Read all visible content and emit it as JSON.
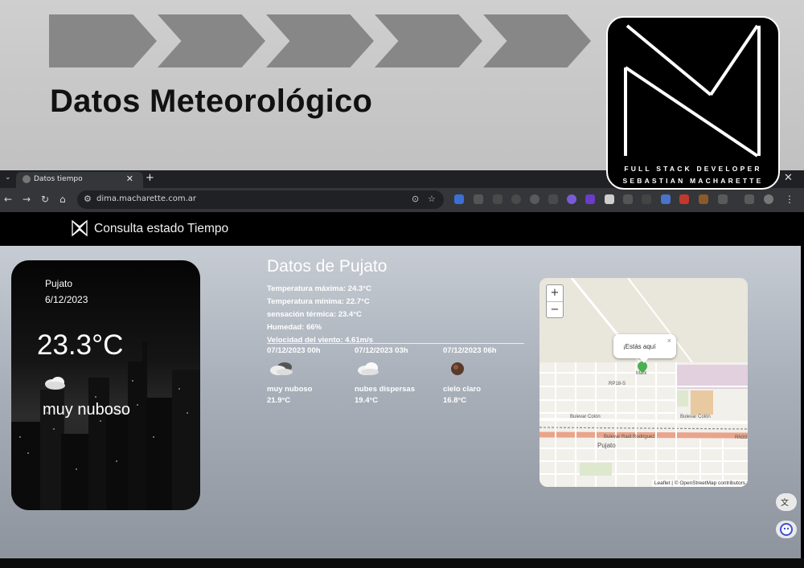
{
  "banner": {
    "title": "Datos Meteorológico",
    "logo_line1": "FULL STACK DEVELOPER",
    "logo_line2": "SEBASTIAN MACHARETTE"
  },
  "browser": {
    "tab_title": "Datos tiempo",
    "url": "dima.macharette.com.ar"
  },
  "site": {
    "header_title": "Consulta estado Tiempo"
  },
  "weather_card": {
    "city": "Pujato",
    "date": "6/12/2023",
    "temperature": "23.3°C",
    "description": "muy nuboso",
    "icon": "cloud-icon"
  },
  "details": {
    "title": "Datos de Pujato",
    "stats": [
      "Temperatura máxima: 24.3°C",
      "Temperatura mínima: 22.7°C",
      "sensación térmica: 23.4°C",
      "Humedad: 66%",
      "Velocidad del viento: 4.61m/s"
    ],
    "forecast": [
      {
        "time": "07/12/2023 00h",
        "description": "muy nuboso",
        "temp": "21.9°C",
        "icon": "cloudy-icon"
      },
      {
        "time": "07/12/2023 03h",
        "description": "nubes dispersas",
        "temp": "19.4°C",
        "icon": "scattered-clouds-icon"
      },
      {
        "time": "07/12/2023 06h",
        "description": "cielo claro",
        "temp": "16.8°C",
        "icon": "clear-sky-icon"
      }
    ]
  },
  "map": {
    "zoom_in": "+",
    "zoom_out": "−",
    "popup": "¡Estás aquí",
    "popup_close": "×",
    "attribution": "Leaflet | © OpenStreetMap contributors",
    "labels": {
      "route": "RP18-S",
      "street1": "Bulevar Colón",
      "street2": "Bulevar Raúl Rodriguez",
      "town": "Pujato",
      "marker": "Mark",
      "rn": "RN33"
    }
  },
  "colors": {
    "banner_chevron": "#878787",
    "content_top": "#c7ccd3",
    "content_bottom": "#8e949e"
  }
}
